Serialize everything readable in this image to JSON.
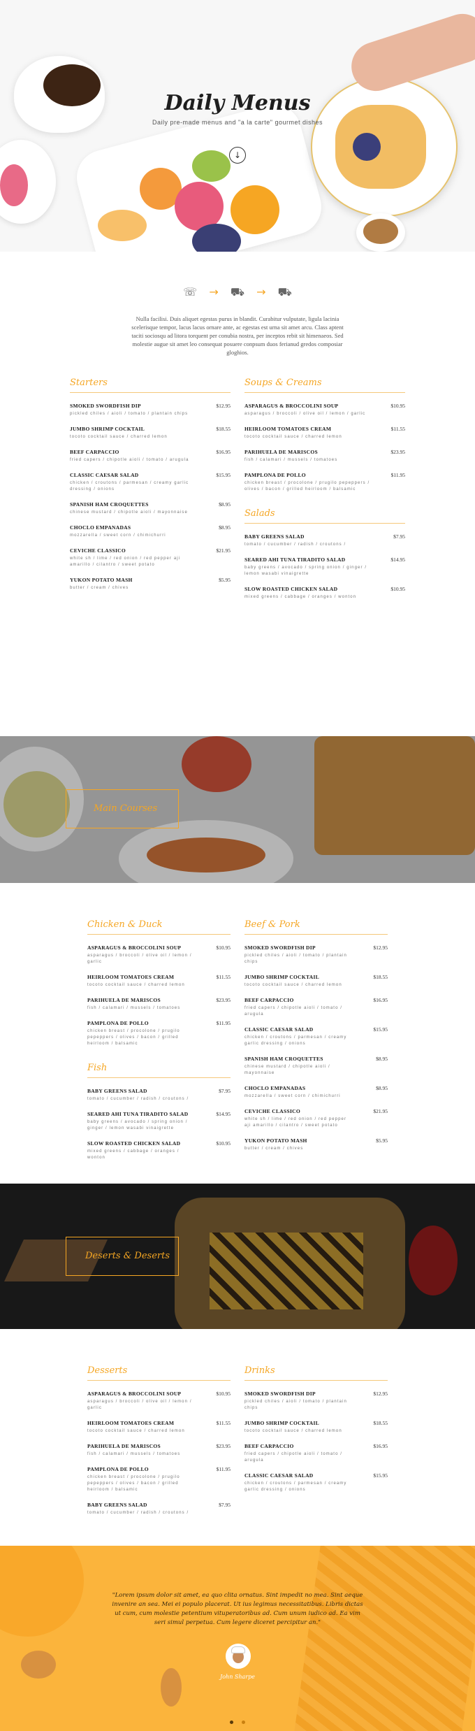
{
  "hero": {
    "title": "Daily Menus",
    "subtitle": "Daily pre-made menus and \"a la carte\" gourmet dishes",
    "down_icon": "arrow-down-circle-icon"
  },
  "intro": {
    "icons": [
      "phone-icon",
      "arrow-right-icon",
      "scooter-icon",
      "arrow-right-icon",
      "truck-icon"
    ],
    "text": "Nulla facilisi. Duis aliquet egestas purus in blandit. Curabitur vulputate, ligula lacinia scelerisque tempor, lacus lacus ornare ante, ac egestas est urna sit amet arcu. Class aptent taciti sociosqu ad litora torquent per conubia nostra, per inceptos rebit sit himenaeos. Sed molestie augue sit amet leo consequat posuere conpsum duos ferianud gredos composiar gloghios."
  },
  "section1": {
    "left": [
      {
        "category": "Starters",
        "items": [
          {
            "name": "SMOKED SWORDFISH DIP",
            "desc": "pickled chiles / aioli / tomato / plantain chips",
            "price": "$12.95"
          },
          {
            "name": "JUMBO SHRIMP COCKTAIL",
            "desc": "tocoto cocktail sauce / charred lemon",
            "price": "$18.55"
          },
          {
            "name": "BEEF CARPACCIO",
            "desc": "fried capers / chipotle aioli / tomato / arugula",
            "price": "$16.95"
          },
          {
            "name": "CLASSIC CAESAR SALAD",
            "desc": "chicken / croutons / parmesan / creamy garlic dressing / onions",
            "price": "$15.95"
          },
          {
            "name": "SPANISH HAM CROQUETTES",
            "desc": "chinese mustard / chipotle aioli / mayonnaise",
            "price": "$8.95"
          },
          {
            "name": "CHOCLO EMPANADAS",
            "desc": "mozzarella / sweet corn / chimichurri",
            "price": "$8.95"
          },
          {
            "name": "CEVICHE CLASSICO",
            "desc": "white sh / lime / red onion / red pepper aji amarillo / cilantro / sweet potato",
            "price": "$21.95"
          },
          {
            "name": "YUKON POTATO MASH",
            "desc": "butter / cream / chives",
            "price": "$5.95"
          }
        ]
      }
    ],
    "right": [
      {
        "category": "Soups & Creams",
        "items": [
          {
            "name": "ASPARAGUS & BROCCOLINI SOUP",
            "desc": "asparagus / broccoli / olive oil / lemon / garlic",
            "price": "$10.95"
          },
          {
            "name": "HEIRLOOM TOMATOES CREAM",
            "desc": "tocoto cocktail sauce / charred lemon",
            "price": "$11.55"
          },
          {
            "name": "PARIHUELA DE MARISCOS",
            "desc": "fish / calamari / mussels / tomatoes",
            "price": "$23.95"
          },
          {
            "name": "PAMPLONA DE POLLO",
            "desc": "chicken breast / procolone / prugilo pepeppers / olives / bacon / grilled heirloom / balsamic",
            "price": "$11.95"
          }
        ]
      },
      {
        "category": "Salads",
        "items": [
          {
            "name": "BABY GREENS SALAD",
            "desc": "tomato / cucumber / radish / croutons /",
            "price": "$7.95"
          },
          {
            "name": "SEARED AHI TUNA TIRADITO SALAD",
            "desc": "baby greens / avocado / spring onion / ginger / lemon wasabi vinaigrette",
            "price": "$14.95"
          },
          {
            "name": "SLOW ROASTED CHICKEN SALAD",
            "desc": "mixed greens / cabbage / oranges / wonton",
            "price": "$10.95"
          }
        ]
      }
    ]
  },
  "banner1": {
    "title": "Main Courses"
  },
  "section2": {
    "left": [
      {
        "category": "Chicken & Duck",
        "items": [
          {
            "name": "ASPARAGUS & BROCCOLINI SOUP",
            "desc": "asparagus / broccoli / olive oil / lemon / garlic",
            "price": "$10.95"
          },
          {
            "name": "HEIRLOOM TOMATOES CREAM",
            "desc": "tocoto cocktail sauce / charred lemon",
            "price": "$11.55"
          },
          {
            "name": "PARIHUELA DE MARISCOS",
            "desc": "fish / calamari / mussels / tomatoes",
            "price": "$23.95"
          },
          {
            "name": "PAMPLONA DE POLLO",
            "desc": "chicken breast / procolone / prugilo pepeppers / olives / bacon / grilled heirloom / balsamic",
            "price": "$11.95"
          }
        ]
      },
      {
        "category": "Fish",
        "items": [
          {
            "name": "BABY GREENS SALAD",
            "desc": "tomato / cucumber / radish / croutons /",
            "price": "$7.95"
          },
          {
            "name": "SEARED AHI TUNA TIRADITO SALAD",
            "desc": "baby greens / avocado / spring onion / ginger / lemon wasabi vinaigrette",
            "price": "$14.95"
          },
          {
            "name": "SLOW ROASTED CHICKEN SALAD",
            "desc": "mixed greens / cabbage / oranges / wonton",
            "price": "$10.95"
          }
        ]
      }
    ],
    "right": [
      {
        "category": "Beef & Pork",
        "items": [
          {
            "name": "SMOKED SWORDFISH DIP",
            "desc": "pickled chiles / aioli / tomato / plantain chips",
            "price": "$12.95"
          },
          {
            "name": "JUMBO SHRIMP COCKTAIL",
            "desc": "tocoto cocktail sauce / charred lemon",
            "price": "$18.55"
          },
          {
            "name": "BEEF CARPACCIO",
            "desc": "fried capers / chipotle aioli / tomato / arugula",
            "price": "$16.95"
          },
          {
            "name": "CLASSIC CAESAR SALAD",
            "desc": "chicken / croutons / parmesan / creamy garlic dressing / onions",
            "price": "$15.95"
          },
          {
            "name": "SPANISH HAM CROQUETTES",
            "desc": "chinese mustard / chipotle aioli / mayonnaise",
            "price": "$8.95"
          },
          {
            "name": "CHOCLO EMPANADAS",
            "desc": "mozzarella / sweet corn / chimichurri",
            "price": "$8.95"
          },
          {
            "name": "CEVICHE CLASSICO",
            "desc": "white sh / lime / red onion / red pepper aji amarillo / cilantro / sweet potato",
            "price": "$21.95"
          },
          {
            "name": "YUKON POTATO MASH",
            "desc": "butter / cream / chives",
            "price": "$5.95"
          }
        ]
      }
    ]
  },
  "banner2": {
    "title": "Deserts & Deserts"
  },
  "section3": {
    "left": [
      {
        "category": "Desserts",
        "items": [
          {
            "name": "ASPARAGUS & BROCCOLINI SOUP",
            "desc": "asparagus / broccoli / olive oil / lemon / garlic",
            "price": "$10.95"
          },
          {
            "name": "HEIRLOOM TOMATOES CREAM",
            "desc": "tocoto cocktail sauce / charred lemon",
            "price": "$11.55"
          },
          {
            "name": "PARIHUELA DE MARISCOS",
            "desc": "fish / calamari / mussels / tomatoes",
            "price": "$23.95"
          },
          {
            "name": "PAMPLONA DE POLLO",
            "desc": "chicken breast / procolone / prugilo pepeppers / olives / bacon / grilled heirloom / balsamic",
            "price": "$11.95"
          },
          {
            "name": "BABY GREENS SALAD",
            "desc": "tomato / cucumber / radish / croutons /",
            "price": "$7.95"
          }
        ]
      }
    ],
    "right": [
      {
        "category": "Drinks",
        "items": [
          {
            "name": "SMOKED SWORDFISH DIP",
            "desc": "pickled chiles / aioli / tomato / plantain chips",
            "price": "$12.95"
          },
          {
            "name": "JUMBO SHRIMP COCKTAIL",
            "desc": "tocoto cocktail sauce / charred lemon",
            "price": "$18.55"
          },
          {
            "name": "BEEF CARPACCIO",
            "desc": "fried capers / chipotle aioli / tomato / arugula",
            "price": "$16.95"
          },
          {
            "name": "CLASSIC CAESAR SALAD",
            "desc": "chicken / croutons / parmesan / creamy garlic dressing / onions",
            "price": "$15.95"
          }
        ]
      }
    ]
  },
  "testimonial": {
    "quote": "\"Lorem ipsum dolor sit amet, ea quo clita ornatus. Sint impedit no mea. Sint aeque invenire an sea. Mei ei populo placerat. Ut ius legimus necessitatibus. Libris dictas ut cum, cum molestie petentium vituperatoribus ad. Cum unum iudico ad. Ea vim seri simul perpetua. Cum legere diceret percipitur an.\"",
    "name": "John Sharpe",
    "dots": 2,
    "active_dot": 0
  },
  "colors": {
    "accent": "#f5a623",
    "accent_light": "#f5c87a",
    "testimonial_bg": "#fbb43c"
  }
}
